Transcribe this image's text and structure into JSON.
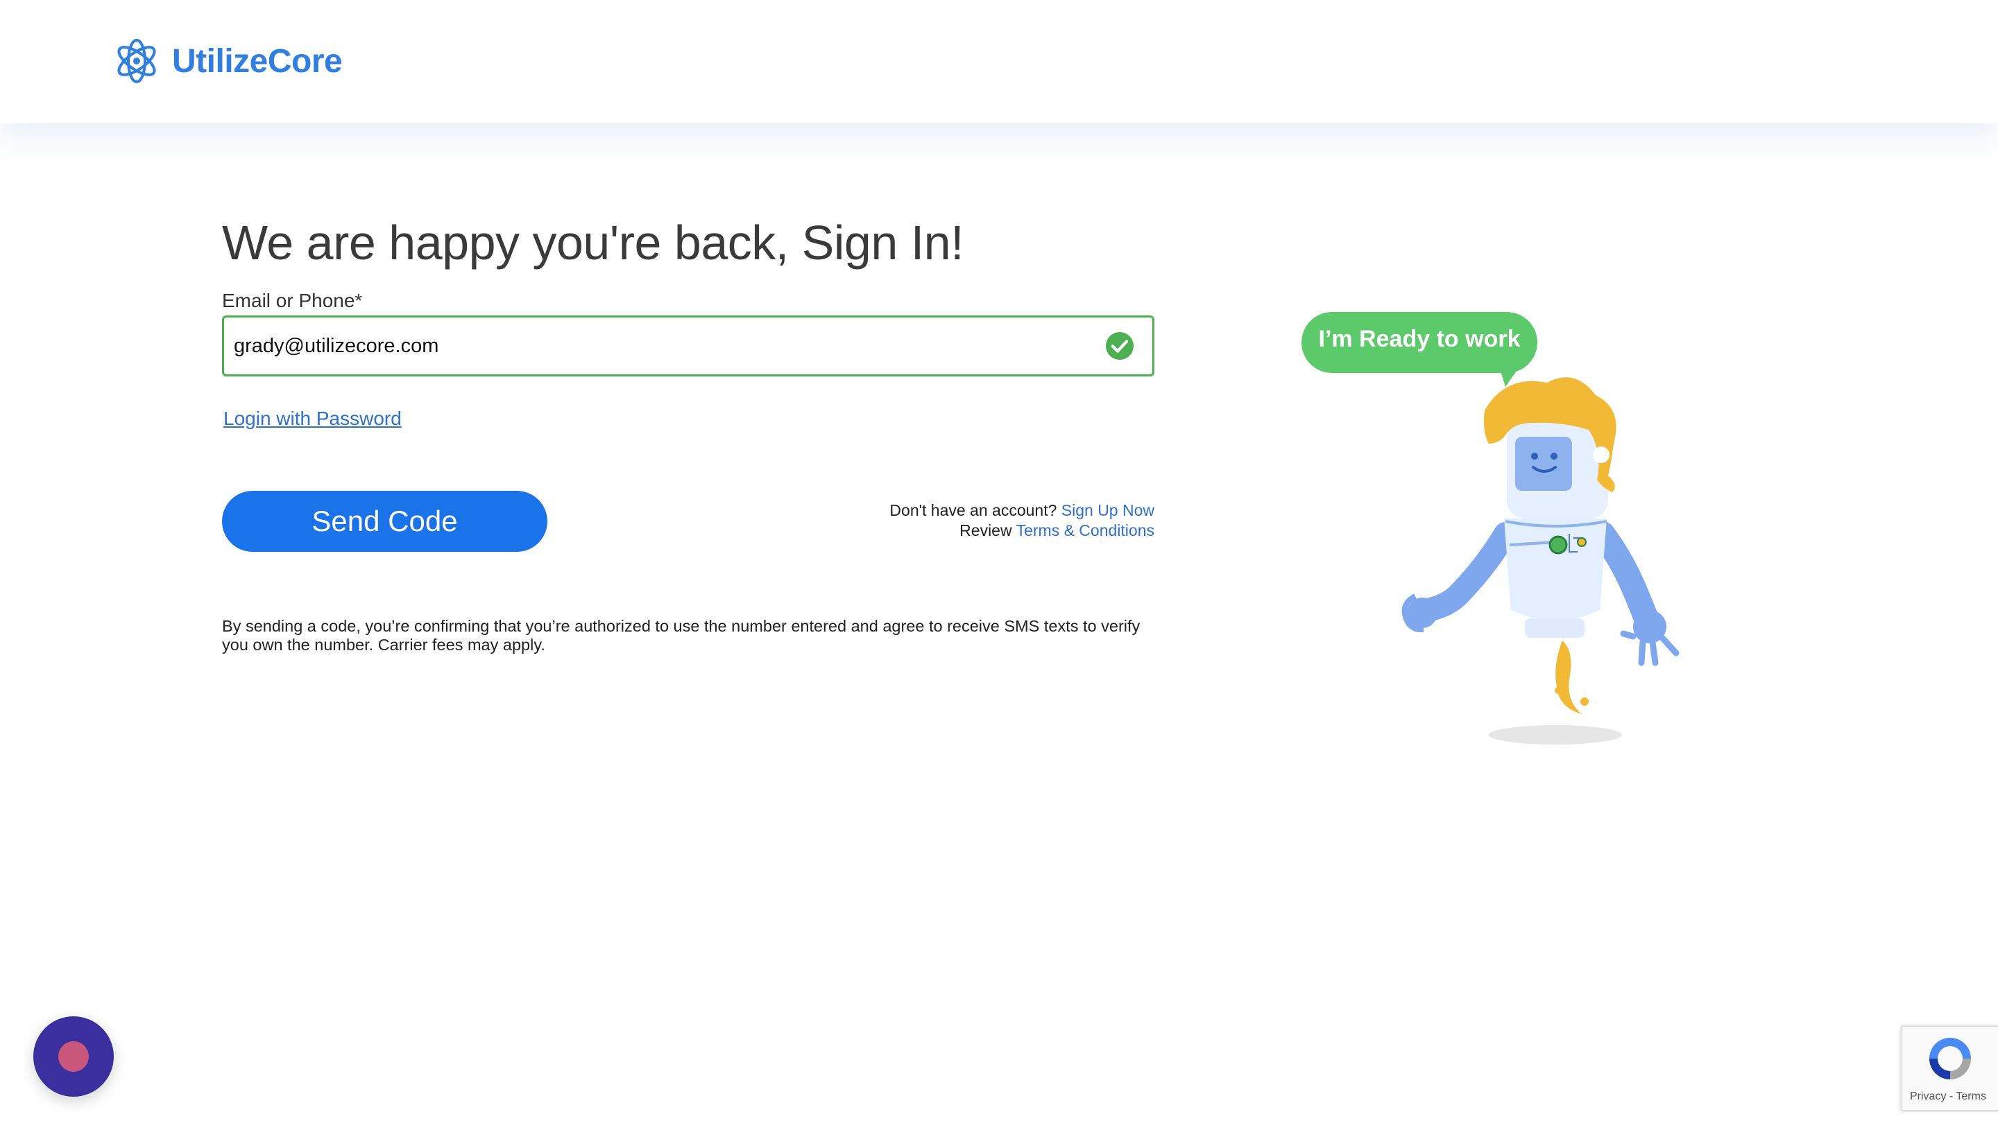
{
  "brand": {
    "name": "UtilizeCore",
    "color": "#2f7ee0"
  },
  "login": {
    "title": "We are happy you're back, Sign In!",
    "field_label": "Email or Phone*",
    "field_value": "grady@utilizecore.com",
    "field_valid": true,
    "password_link": "Login with Password",
    "send_button": "Send Code",
    "no_account_text": "Don't have an account?",
    "signup_link": "Sign Up Now",
    "review_text": "Review",
    "terms_link": "Terms & Conditions",
    "disclaimer": "By sending a code, you’re confirming that you’re authorized to use the number entered and agree to receive SMS texts to verify you own the number. Carrier fees may apply."
  },
  "illustration": {
    "speech_bubble": "I’m Ready to work",
    "icon": "robot-illustration"
  },
  "widgets": {
    "chat_icon": "chat-launcher-icon",
    "recaptcha_links": "Privacy - Terms"
  },
  "colors": {
    "primary_button": "#1a73e8",
    "valid_border": "#4caf50",
    "link": "#2f6fd0",
    "bubble": "#5cc96b"
  }
}
